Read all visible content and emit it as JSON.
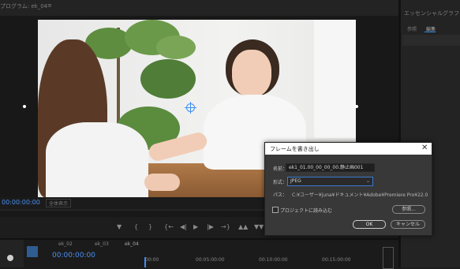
{
  "program_monitor": {
    "tab_label": "プログラム: ek_04",
    "menu_icon": "hamburger-icon",
    "timecode": "00:00:00:00",
    "fit_label": "全体表示"
  },
  "effect_controls": {
    "title": "エッセンシャルグラフィックス",
    "tab_browse": "参照",
    "tab_edit": "編集"
  },
  "transport": {
    "icons": [
      "marker-icon",
      "in-point-icon",
      "out-point-icon",
      "go-to-in-icon",
      "step-back-icon",
      "play-icon",
      "step-forward-icon",
      "go-to-out-icon",
      "lift-icon",
      "extract-icon"
    ],
    "glyphs": [
      "▼",
      "{",
      "}",
      "{←",
      "◀|",
      "▶",
      "|▶",
      "→}",
      "▲▲",
      "▼▼"
    ]
  },
  "timeline": {
    "tabs": [
      "ek_02",
      "ek_03",
      "ek_04"
    ],
    "timecode": "00:00:00:00",
    "ruler": [
      "00:00",
      "00:05:00:00",
      "00:10:00:00",
      "00:15:00:00"
    ]
  },
  "dialog": {
    "title": "フレームを書き出し",
    "name_label": "名前：",
    "name_value": "ek1_01.00_00_00_00.静止画001",
    "format_label": "形式：",
    "format_value": "JPEG",
    "path_label": "パス：",
    "path_value": "C:¥ユーザー¥juna¥ドキュメント¥Adobe¥Premiere Pro¥22.0",
    "import_label": "プロジェクトに読み込む",
    "browse_label": "参照...",
    "ok_label": "OK",
    "cancel_label": "キャンセル"
  },
  "colors": {
    "accent": "#3f8ef0",
    "panel": "#232323",
    "dialog_bg": "#383838"
  }
}
